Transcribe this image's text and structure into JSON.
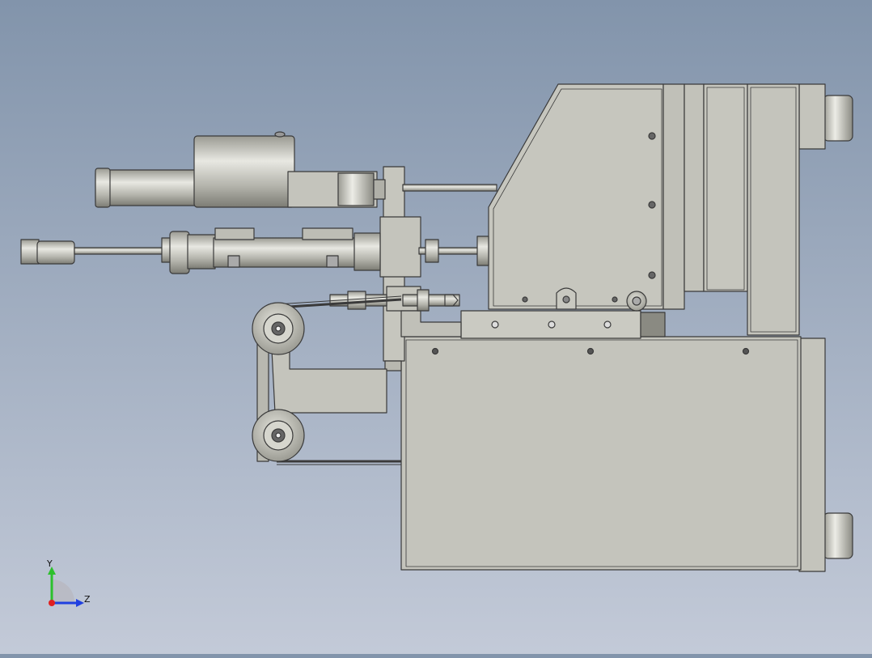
{
  "viewport": {
    "background_top": "#8294ab",
    "background_bottom": "#c3cad8",
    "part_color": "#c8c8c0",
    "edge_color": "#3a3a3a"
  },
  "triad": {
    "y_label": "Y",
    "z_label": "Z",
    "y_color": "#2cc02c",
    "z_color": "#2040e0",
    "x_color": "#e02020"
  }
}
